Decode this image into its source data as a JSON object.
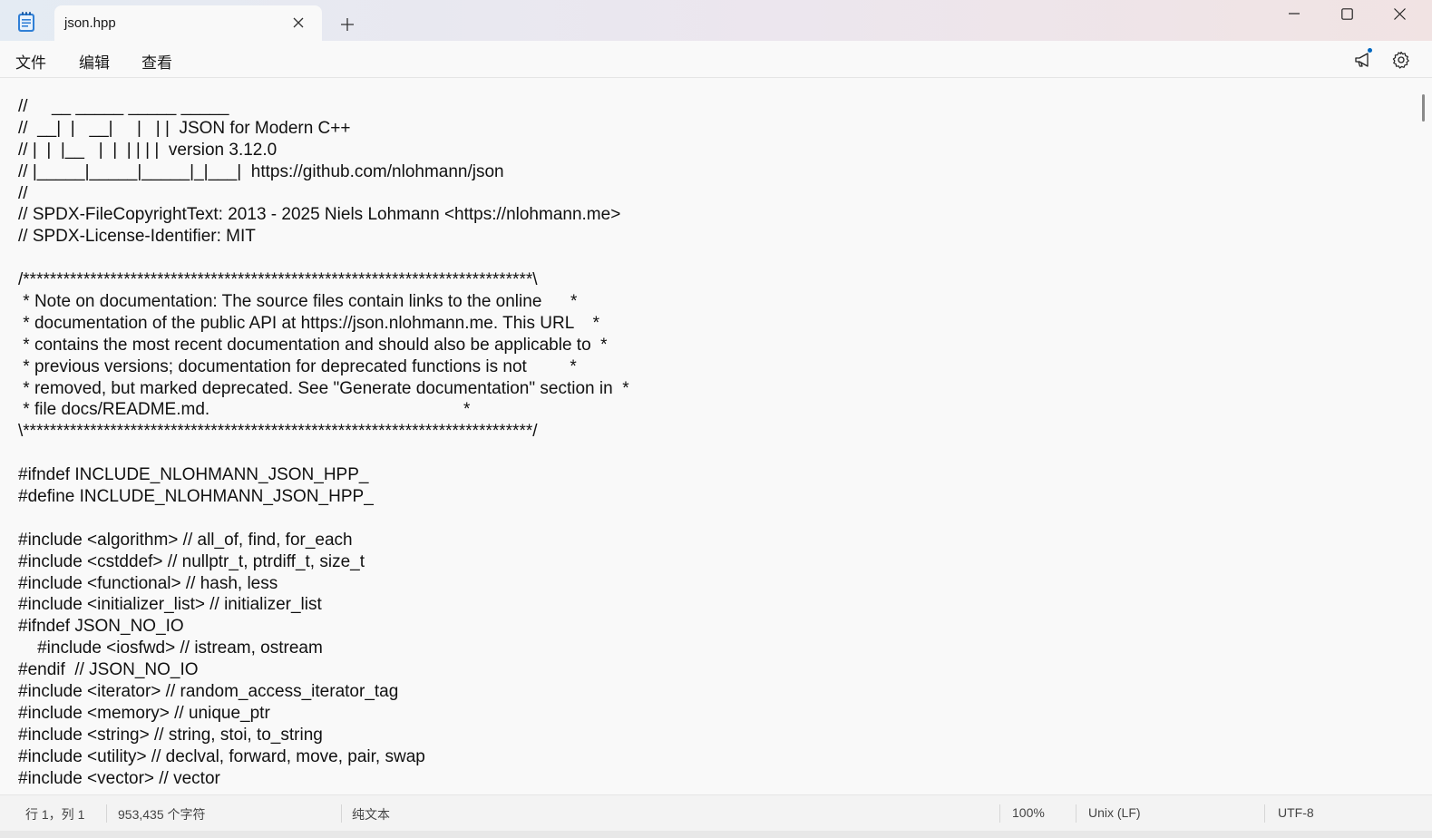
{
  "titlebar": {
    "tab_title": "json.hpp",
    "icons": {
      "app": "notepad-icon",
      "close_tab": "close-icon",
      "new_tab": "plus-icon",
      "minimize": "minimize-icon",
      "maximize": "maximize-icon",
      "close": "close-icon"
    }
  },
  "menu": {
    "file": "文件",
    "edit": "编辑",
    "view": "查看",
    "icons": {
      "announcement": "megaphone-icon",
      "settings": "gear-icon"
    },
    "accent_color": "#0067c0"
  },
  "editor": {
    "lines": [
      "//     __ _____ _____ _____",
      "//  __|  |   __|     |   | |  JSON for Modern C++",
      "// |  |  |__   |  |  | | | |  version 3.12.0",
      "// |_____|_____|_____|_|___|  https://github.com/nlohmann/json",
      "//",
      "// SPDX-FileCopyrightText: 2013 - 2025 Niels Lohmann <https://nlohmann.me>",
      "// SPDX-License-Identifier: MIT",
      "",
      "/****************************************************************************\\",
      " * Note on documentation: The source files contain links to the online      *",
      " * documentation of the public API at https://json.nlohmann.me. This URL    *",
      " * contains the most recent documentation and should also be applicable to  *",
      " * previous versions; documentation for deprecated functions is not         *",
      " * removed, but marked deprecated. See \"Generate documentation\" section in  *",
      " * file docs/README.md.                                                     *",
      "\\****************************************************************************/",
      "",
      "#ifndef INCLUDE_NLOHMANN_JSON_HPP_",
      "#define INCLUDE_NLOHMANN_JSON_HPP_",
      "",
      "#include <algorithm> // all_of, find, for_each",
      "#include <cstddef> // nullptr_t, ptrdiff_t, size_t",
      "#include <functional> // hash, less",
      "#include <initializer_list> // initializer_list",
      "#ifndef JSON_NO_IO",
      "    #include <iosfwd> // istream, ostream",
      "#endif  // JSON_NO_IO",
      "#include <iterator> // random_access_iterator_tag",
      "#include <memory> // unique_ptr",
      "#include <string> // string, stoi, to_string",
      "#include <utility> // declval, forward, move, pair, swap",
      "#include <vector> // vector"
    ]
  },
  "status": {
    "position": "行 1，列 1",
    "char_count": "953,435 个字符",
    "format": "纯文本",
    "zoom": "100%",
    "line_ending": "Unix (LF)",
    "encoding": "UTF-8"
  }
}
